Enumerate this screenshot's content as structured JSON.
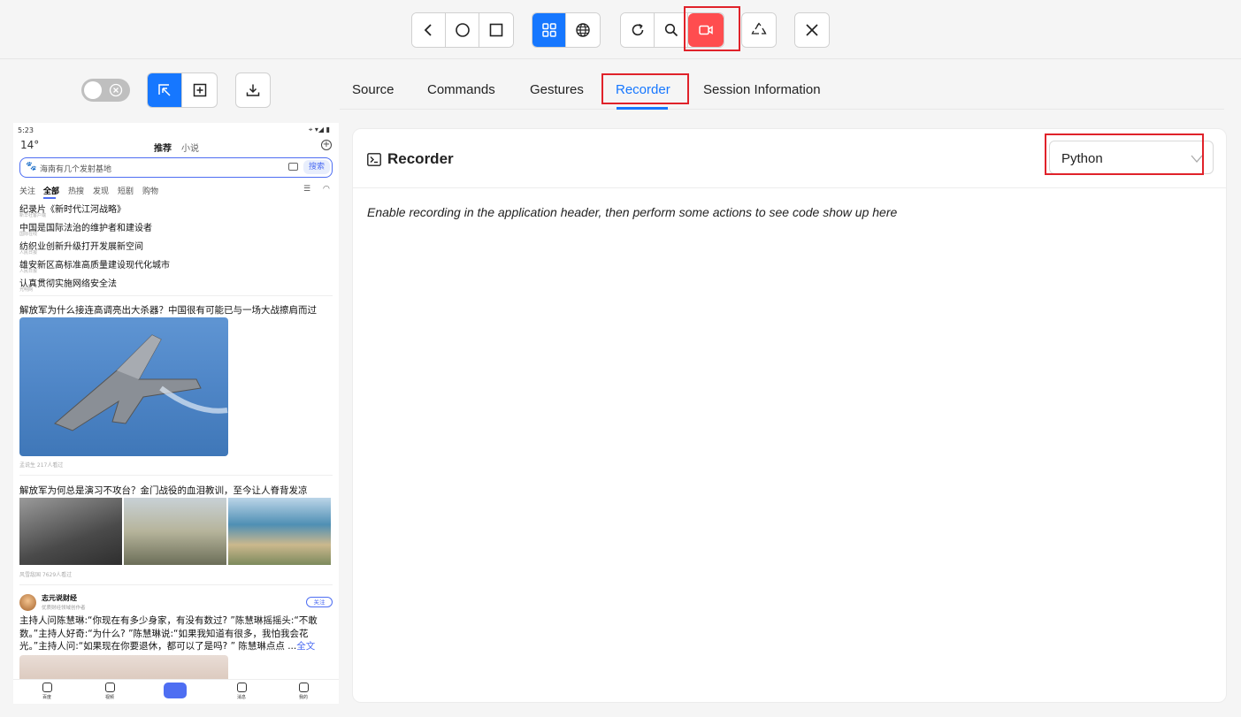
{
  "toolbar": {
    "nav_buttons": [
      "back-icon",
      "home-icon",
      "app-switch-icon"
    ],
    "mode_buttons": [
      "native-apps-icon",
      "web-globe-icon"
    ],
    "action_buttons": [
      "refresh-icon",
      "search-icon",
      "record-icon"
    ],
    "extra_buttons": [
      "recycle-icon"
    ],
    "close_button": "close-icon",
    "accent_color": "#1677ff",
    "record_color": "#ff4d4f"
  },
  "tabs": [
    "Source",
    "Commands",
    "Gestures",
    "Recorder",
    "Session Information"
  ],
  "active_tab": "Recorder",
  "panel": {
    "title": "Recorder",
    "language": "Python",
    "message": "Enable recording in the application header, then perform some actions to see code show up here"
  },
  "phone": {
    "time": "5:23",
    "temp": "14°",
    "top_tabs": [
      "推荐",
      "小说"
    ],
    "search_text": "海南有几个发射基地",
    "search_button": "搜索",
    "categories": [
      "关注",
      "全部",
      "热搜",
      "发现",
      "短剧",
      "购物"
    ],
    "news": [
      {
        "title": "纪录片《新时代江河战略》",
        "source": "新华社客户端"
      },
      {
        "title": "中国是国际法治的维护者和建设者",
        "source": "国际在线"
      },
      {
        "title": "纺织业创新升级打开发展新空间",
        "source": "人民日报"
      },
      {
        "title": "雄安新区高标准高质量建设现代化城市",
        "source": "人民日报"
      },
      {
        "title": "认真贯彻实施网络安全法",
        "source": "光明网"
      }
    ],
    "article1": {
      "title": "解放军为什么接连高调亮出大杀器？中国很有可能已与一场大战擦肩而过",
      "meta": "孟说生  217人看过"
    },
    "article2": {
      "title": "解放军为何总是演习不攻台？金门战役的血泪教训，至今让人脊背发凉",
      "meta": "风雪敌国  7629人看过"
    },
    "post": {
      "author": "志元说财经",
      "author_sub": "优质财经领域创作者",
      "follow": "关注",
      "text": "主持人问陈慧琳:“你现在有多少身家，有没有数过? ”陈慧琳摇摇头:“不敢数。”主持人好奇:“为什么? ”陈慧琳说:“如果我知道有很多，我怕我会花光。”主持人问:“如果现在你要退休，都可以了是吗? ” 陈慧琳点点 ...",
      "more": "全文"
    },
    "bottom_nav": [
      "百度",
      "视频",
      "消息",
      "我的"
    ]
  }
}
